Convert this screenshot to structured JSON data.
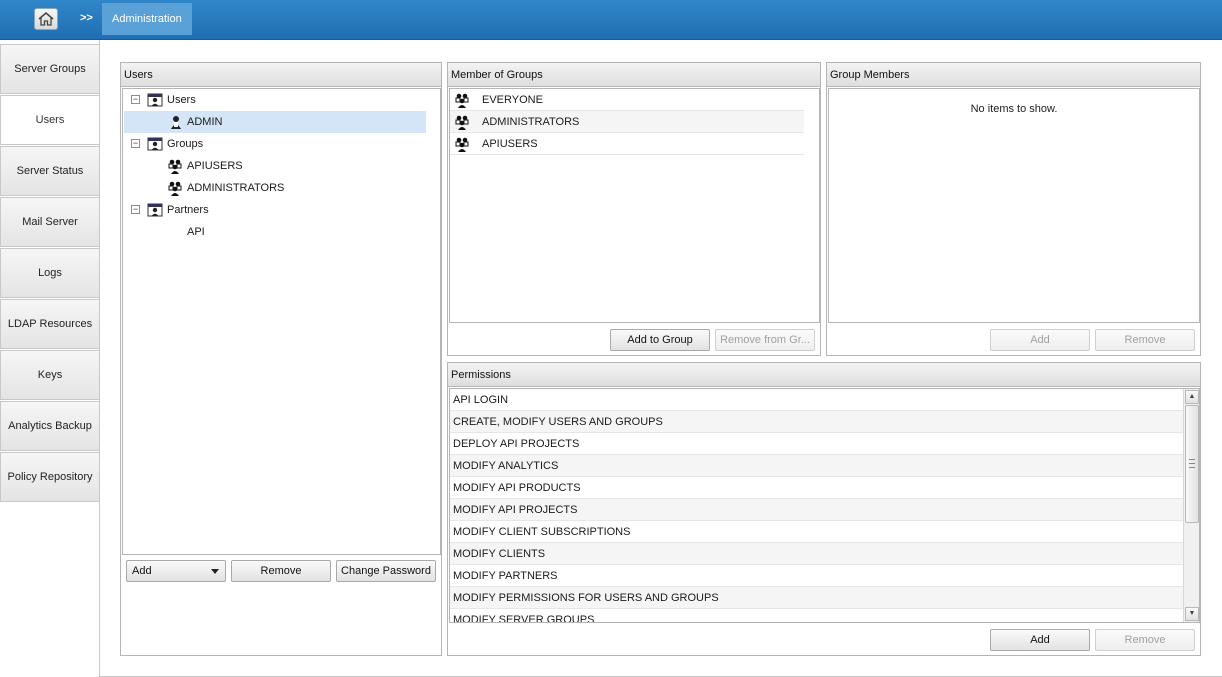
{
  "breadcrumb": {
    "separator": ">>",
    "current": "Administration"
  },
  "icons": {
    "home": "home-icon",
    "user": "user-icon",
    "folder": "user-folder-icon",
    "group": "group-icon"
  },
  "nav": {
    "items": [
      {
        "label": "Server Groups"
      },
      {
        "label": "Users",
        "active": true
      },
      {
        "label": "Server Status"
      },
      {
        "label": "Mail Server"
      },
      {
        "label": "Logs"
      },
      {
        "label": "LDAP Resources"
      },
      {
        "label": "Keys"
      },
      {
        "label": "Analytics Backup"
      },
      {
        "label": "Policy Repository"
      }
    ]
  },
  "users_panel": {
    "title": "Users",
    "tree": [
      {
        "label": "Users",
        "toggle": "−"
      },
      {
        "label": "ADMIN",
        "selected": true
      },
      {
        "label": "Groups",
        "toggle": "−"
      },
      {
        "label": "APIUSERS"
      },
      {
        "label": "ADMINISTRATORS"
      },
      {
        "label": "Partners",
        "toggle": "−"
      },
      {
        "label": "API"
      }
    ],
    "add_select": "Add",
    "remove_label": "Remove",
    "change_password_label": "Change Password"
  },
  "member_panel": {
    "title": "Member of Groups",
    "rows": [
      "EVERYONE",
      "ADMINISTRATORS",
      "APIUSERS"
    ],
    "add_label": "Add to Group",
    "remove_label": "Remove from Gr..."
  },
  "group_members_panel": {
    "title": "Group Members",
    "empty_text": "No items to show.",
    "add_label": "Add",
    "remove_label": "Remove"
  },
  "permissions_panel": {
    "title": "Permissions",
    "rows": [
      "API LOGIN",
      "CREATE, MODIFY USERS AND GROUPS",
      "DEPLOY API PROJECTS",
      "MODIFY ANALYTICS",
      "MODIFY API PRODUCTS",
      "MODIFY API PROJECTS",
      "MODIFY CLIENT SUBSCRIPTIONS",
      "MODIFY CLIENTS",
      "MODIFY PARTNERS",
      "MODIFY PERMISSIONS FOR USERS AND GROUPS",
      "MODIFY SERVER GROUPS"
    ],
    "add_label": "Add",
    "remove_label": "Remove"
  }
}
